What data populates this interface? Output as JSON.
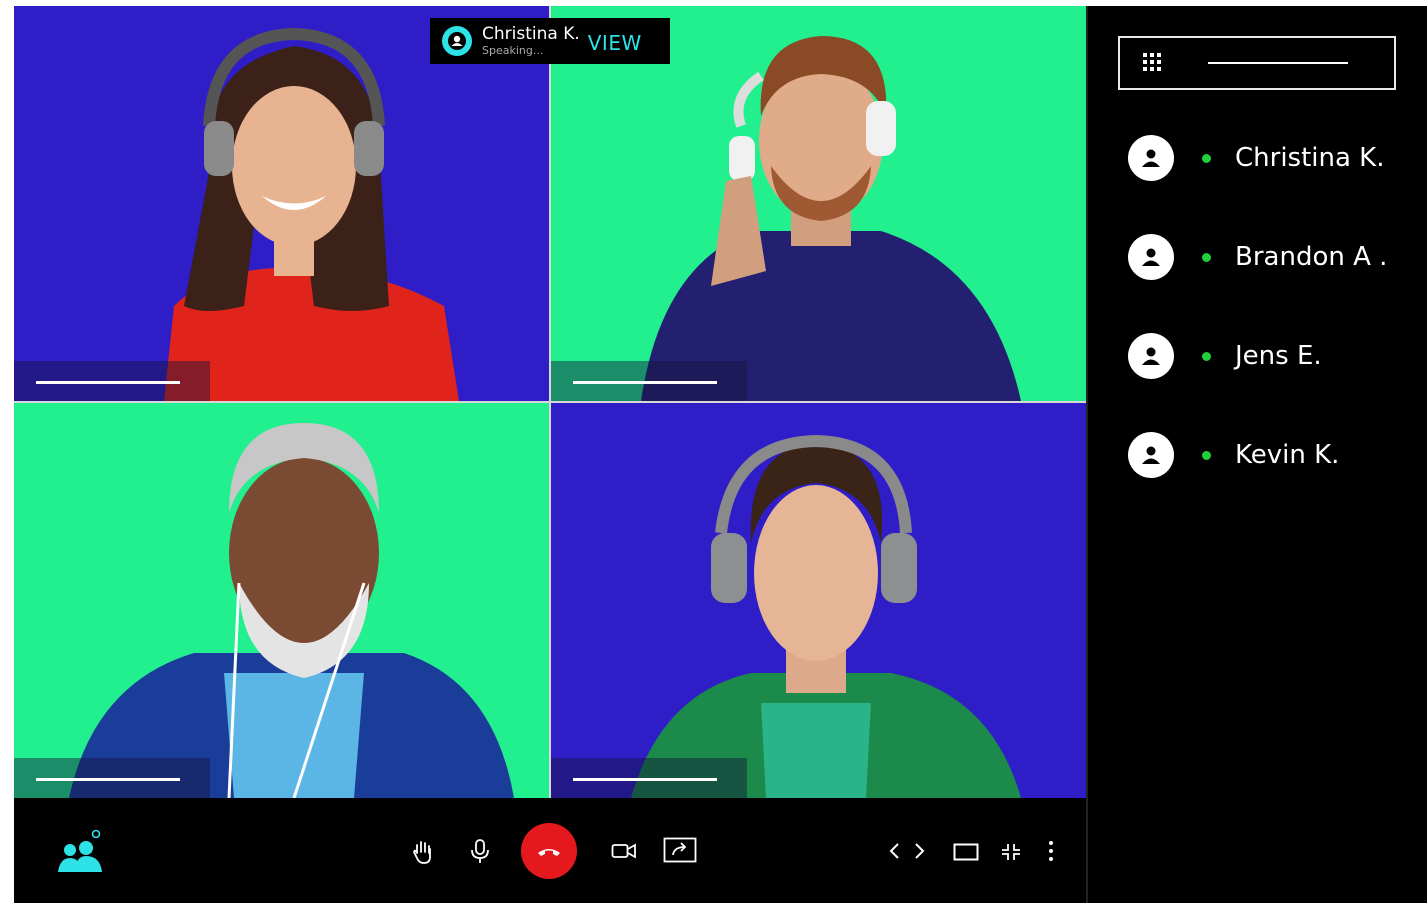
{
  "speaker": {
    "name": "Christina K.",
    "status": "Speaking...",
    "view_label": "VIEW"
  },
  "participants": [
    {
      "name": "Christina K."
    },
    {
      "name": "Brandon A ."
    },
    {
      "name": "Jens E."
    },
    {
      "name": "Kevin K."
    }
  ],
  "colors": {
    "tile_blue": "#2f1dc7",
    "tile_green": "#22f08e",
    "accent_cyan": "#2de2e6",
    "hangup_red": "#e5191d",
    "online_green": "#1fd03a"
  },
  "icons": {
    "people": "people-icon",
    "hand": "raise-hand-icon",
    "mic": "microphone-icon",
    "hangup": "hang-up-icon",
    "camera": "camera-icon",
    "share": "share-screen-icon",
    "prev": "chevron-left-icon",
    "next": "chevron-right-icon",
    "layout": "layout-icon",
    "collapse": "collapse-icon",
    "more": "more-vertical-icon",
    "grid": "grid-menu-icon"
  }
}
